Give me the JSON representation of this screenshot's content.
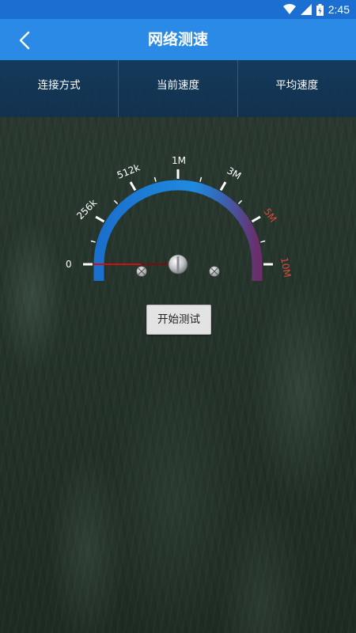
{
  "status_bar": {
    "time": "2:45"
  },
  "app_bar": {
    "title": "网络测速"
  },
  "info_header": {
    "columns": [
      "连接方式",
      "当前速度",
      "平均速度"
    ]
  },
  "gauge": {
    "tick_labels": [
      "0",
      "256k",
      "512k",
      "1M",
      "3M",
      "5M",
      "10M"
    ],
    "current_speed": 0,
    "arc_colors": {
      "start": "#1a78d6",
      "end": "#6a2e6a"
    },
    "needle_color": "#d01010"
  },
  "actions": {
    "start_label": "开始测试"
  }
}
